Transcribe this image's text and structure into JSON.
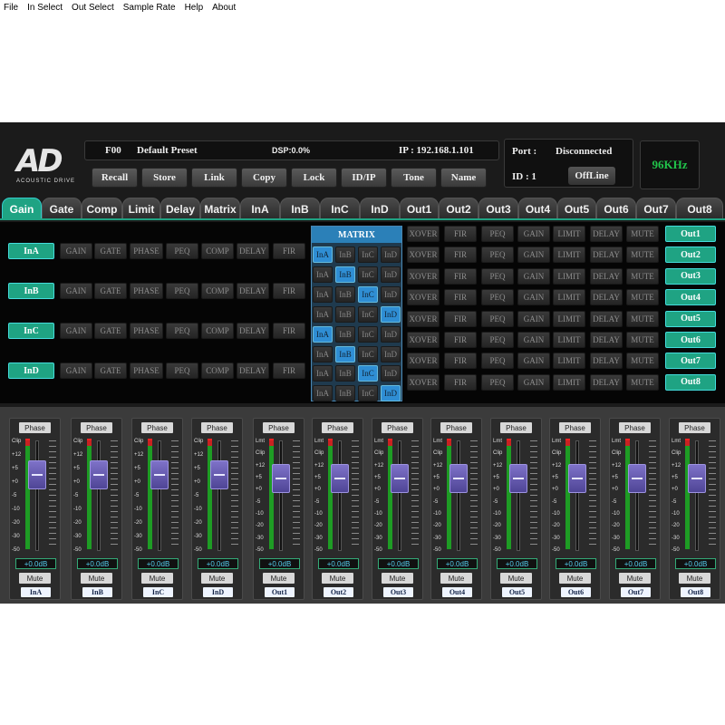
{
  "menu": [
    "File",
    "In Select",
    "Out Select",
    "Sample Rate",
    "Help",
    "About"
  ],
  "logo": {
    "text": "AD",
    "subtitle": "ACOUSTIC DRIVE"
  },
  "preset": {
    "id": "F00",
    "name": "Default Preset",
    "dsp": "DSP:0.0%",
    "ip": "IP : 192.168.1.101"
  },
  "buttons": [
    "Recall",
    "Store",
    "Link",
    "Copy",
    "Lock",
    "ID/IP",
    "Tone",
    "Name"
  ],
  "port": {
    "label": "Port :",
    "value": "Disconnected",
    "id": "ID : 1",
    "status": "OffLine"
  },
  "sample_rate": "96KHz",
  "tabs": [
    "Gain",
    "Gate",
    "Comp",
    "Limit",
    "Delay",
    "Matrix",
    "InA",
    "InB",
    "InC",
    "InD",
    "Out1",
    "Out2",
    "Out3",
    "Out4",
    "Out5",
    "Out6",
    "Out7",
    "Out8"
  ],
  "active_tab": "Gain",
  "inputs": {
    "channels": [
      "InA",
      "InB",
      "InC",
      "InD"
    ],
    "blocks": [
      "GAIN",
      "GATE",
      "PHASE",
      "PEQ",
      "COMP",
      "DELAY",
      "FIR"
    ]
  },
  "matrix": {
    "title": "MATRIX",
    "cols": [
      "InA",
      "InB",
      "InC",
      "InD"
    ],
    "active": [
      0,
      1,
      2,
      3,
      0,
      1,
      2,
      3
    ]
  },
  "outputs": {
    "channels": [
      "Out1",
      "Out2",
      "Out3",
      "Out4",
      "Out5",
      "Out6",
      "Out7",
      "Out8"
    ],
    "blocks": [
      "XOVER",
      "FIR",
      "PEQ",
      "GAIN",
      "LIMIT",
      "DELAY",
      "MUTE"
    ]
  },
  "strips": {
    "labels": [
      "InA",
      "InB",
      "InC",
      "InD",
      "Out1",
      "Out2",
      "Out3",
      "Out4",
      "Out5",
      "Out6",
      "Out7",
      "Out8"
    ],
    "phase": "Phase",
    "mute": "Mute",
    "gain": "+0.0dB",
    "in_scale": [
      "Clip",
      "+12",
      "+5",
      "+0",
      "-5",
      "-10",
      "-20",
      "-30",
      "-50"
    ],
    "out_scale": [
      "Lmt",
      "Clip",
      "+12",
      "+5",
      "+0",
      "-5",
      "-10",
      "-20",
      "-30",
      "-50"
    ]
  },
  "colors": {
    "accent": "#1fa383",
    "matrix_on": "#2f8ed4",
    "rate": "#21c44a",
    "fader": "#6a5fb8"
  }
}
